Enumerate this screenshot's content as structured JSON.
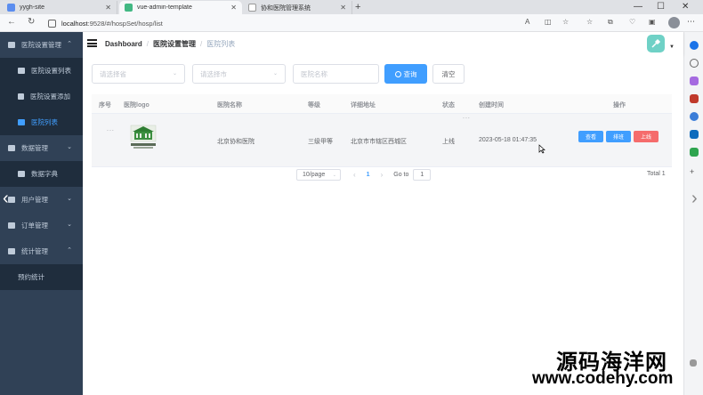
{
  "browser": {
    "tabs": [
      {
        "label": "yygh-site",
        "color": "#5b8def"
      },
      {
        "label": "vue-admin-template",
        "color": "#42b883"
      },
      {
        "label": "协和医院管理系统",
        "color": "#d0d0d0"
      }
    ],
    "url_host": "localhost",
    "url_path": ":9528/#/hospSet/hosp/list"
  },
  "sidebar": {
    "items": [
      {
        "label": "医院设置管理",
        "icon": "gear-icon",
        "level": 1,
        "arrow": "⌃"
      },
      {
        "label": "医院设置列表",
        "icon": "table-icon",
        "level": 2
      },
      {
        "label": "医院设置添加",
        "icon": "tree-icon",
        "level": 2
      },
      {
        "label": "医院列表",
        "icon": "table-icon",
        "level": 2,
        "active": true
      },
      {
        "label": "数据管理",
        "icon": "list-icon",
        "level": 1,
        "arrow": "⌄"
      },
      {
        "label": "数据字典",
        "icon": "table-icon",
        "level": 2
      },
      {
        "label": "用户管理",
        "icon": "user-icon",
        "level": 1,
        "arrow": "⌄"
      },
      {
        "label": "订单管理",
        "icon": "order-icon",
        "level": 1,
        "arrow": "⌄"
      },
      {
        "label": "统计管理",
        "icon": "chart-icon",
        "level": 1,
        "arrow": "⌃"
      },
      {
        "label": "预约统计",
        "icon": "",
        "level": 2
      }
    ]
  },
  "navbar": {
    "breadcrumb": [
      "Dashboard",
      "医院设置管理",
      "医院列表"
    ]
  },
  "filters": {
    "province_placeholder": "请选择省",
    "city_placeholder": "请选择市",
    "name_placeholder": "医院名称",
    "query_label": "查询",
    "clear_label": "清空"
  },
  "table": {
    "headers": [
      "序号",
      "医院logo",
      "医院名称",
      "等级",
      "详细地址",
      "状态",
      "创建时间",
      "操作"
    ],
    "rows": [
      {
        "index": "...",
        "name": "北京协和医院",
        "level": "三级甲等",
        "address": "北京市市辖区西城区",
        "status": "上线",
        "created": "2023-05-18 01:47:35",
        "actions": [
          "查看",
          "排班",
          "上线"
        ]
      }
    ]
  },
  "pagination": {
    "page_size": "10/page",
    "current": "1",
    "goto_label": "Go to",
    "goto_value": "1",
    "total": "Total 1"
  },
  "watermark": {
    "line1": "源码海洋网",
    "line2": "www.codehy.com"
  }
}
